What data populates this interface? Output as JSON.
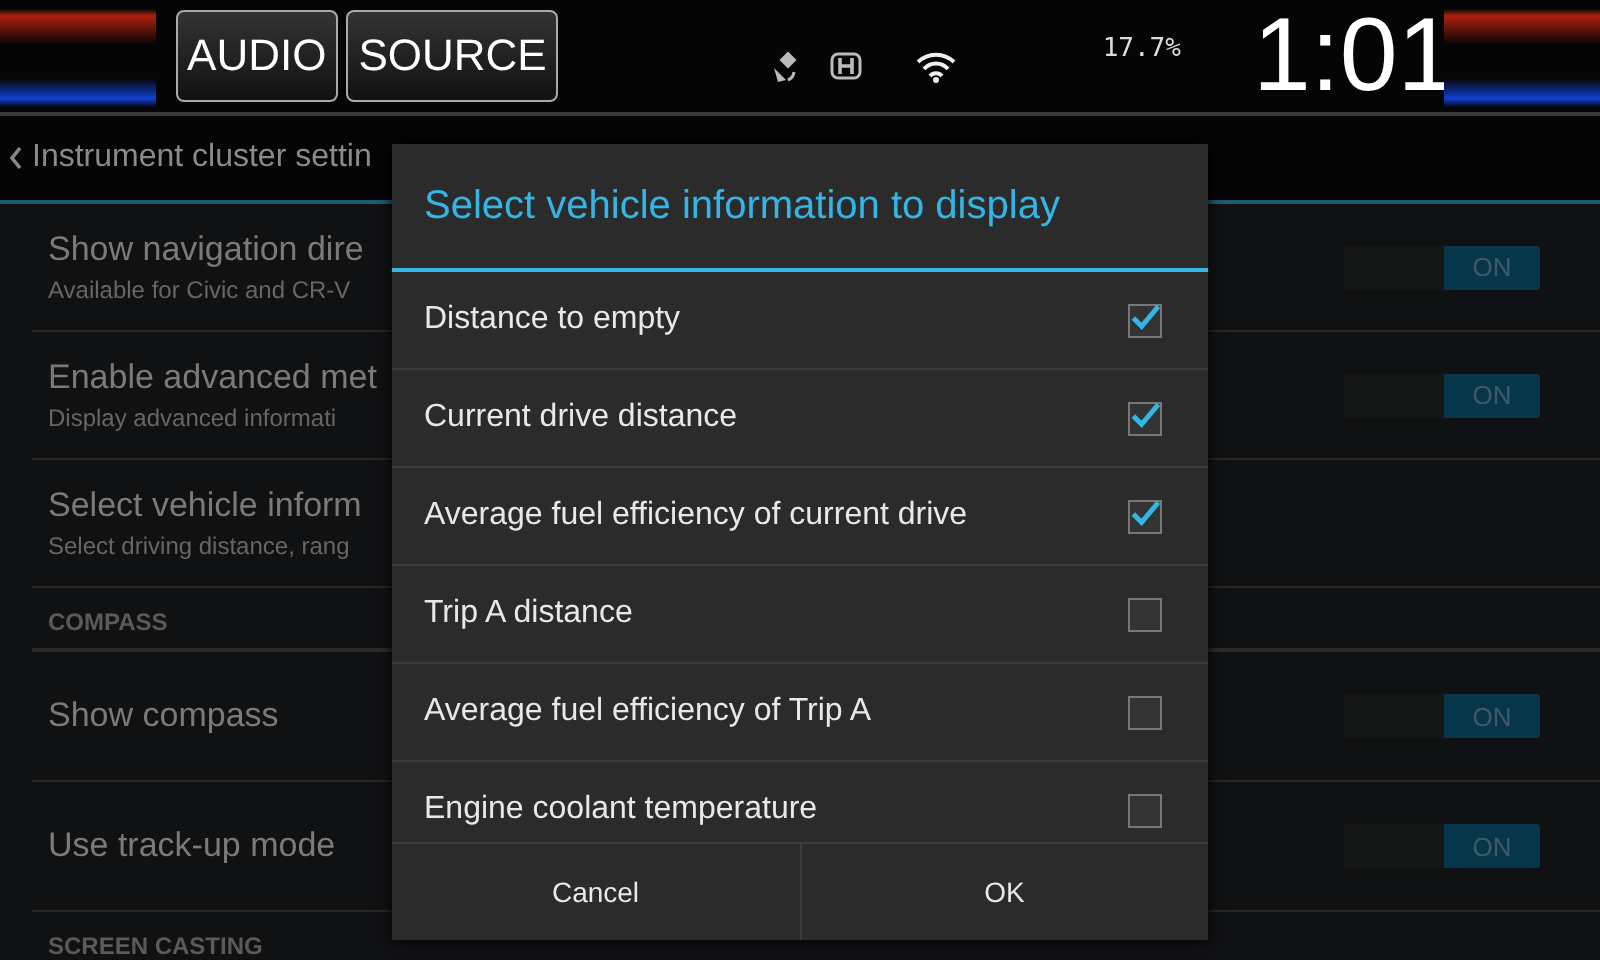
{
  "top_bar": {
    "buttons": [
      "AUDIO",
      "SOURCE"
    ],
    "reading": "17.7%",
    "clock": "1:01"
  },
  "settings": {
    "back_title": "Instrument cluster settin",
    "sections": [
      {
        "rows": [
          {
            "kind": "toggle",
            "title": "Show navigation dire",
            "subtitle": "Available for Civic and CR-V",
            "on": true,
            "toggle_label": "ON"
          },
          {
            "kind": "toggle",
            "title": "Enable advanced met",
            "subtitle": "Display advanced informati",
            "on": true,
            "toggle_label": "ON"
          },
          {
            "kind": "plain",
            "title": "Select vehicle inform",
            "subtitle": "Select driving distance, rang"
          }
        ]
      },
      {
        "header": "COMPASS",
        "rows": [
          {
            "kind": "toggle",
            "title": "Show compass",
            "on": true,
            "toggle_label": "ON"
          },
          {
            "kind": "toggle",
            "title": "Use track-up mode",
            "on": true,
            "toggle_label": "ON"
          }
        ]
      },
      {
        "header": "SCREEN CASTING"
      }
    ]
  },
  "dialog": {
    "title": "Select vehicle information to display",
    "items": [
      {
        "label": "Distance to empty",
        "checked": true
      },
      {
        "label": "Current drive distance",
        "checked": true
      },
      {
        "label": "Average fuel efficiency of current drive",
        "checked": true
      },
      {
        "label": "Trip A distance",
        "checked": false
      },
      {
        "label": "Average fuel efficiency of Trip A",
        "checked": false
      },
      {
        "label": "Engine coolant temperature",
        "checked": false
      }
    ],
    "buttons": [
      "Cancel",
      "OK"
    ]
  }
}
